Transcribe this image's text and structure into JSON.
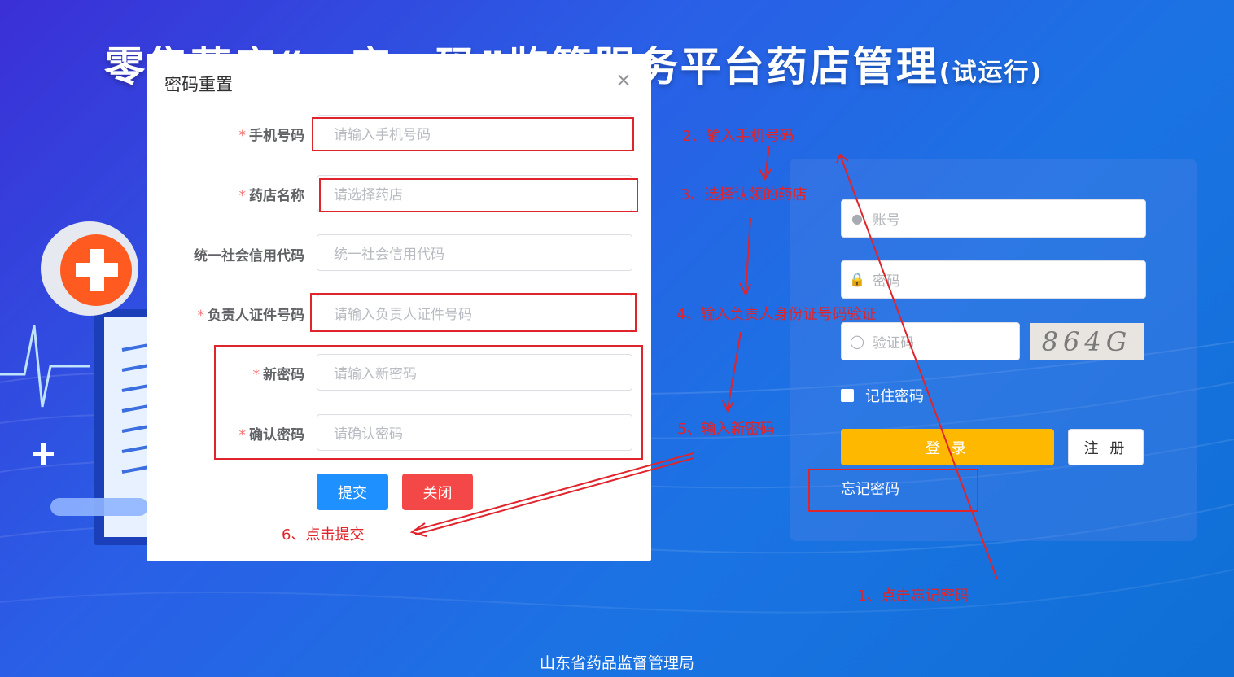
{
  "page": {
    "title": "零售药店“一店一码”监管服务平台药店管理",
    "title_suffix": "(试运行)",
    "footer": "山东省药品监督管理局"
  },
  "login": {
    "account_placeholder": "账号",
    "password_placeholder": "密码",
    "captcha_placeholder": "验证码",
    "captcha_text": "864G",
    "remember_label": "记住密码",
    "login_button": "登 录",
    "register_button": "注 册",
    "forgot_link": "忘记密码"
  },
  "modal": {
    "title": "密码重置",
    "close_icon": "×",
    "fields": [
      {
        "label": "手机号码",
        "required": true,
        "placeholder": "请输入手机号码"
      },
      {
        "label": "药店名称",
        "required": true,
        "placeholder": "请选择药店"
      },
      {
        "label": "统一社会信用代码",
        "required": false,
        "placeholder": "统一社会信用代码"
      },
      {
        "label": "负责人证件号码",
        "required": true,
        "placeholder": "请输入负责人证件号码"
      },
      {
        "label": "新密码",
        "required": true,
        "placeholder": "请输入新密码"
      },
      {
        "label": "确认密码",
        "required": true,
        "placeholder": "请确认密码"
      }
    ],
    "required_mark": "*",
    "submit_button": "提交",
    "close_button": "关闭"
  },
  "annotations": {
    "step1": "1、点击忘记密码",
    "step2": "2、输入手机号码",
    "step3": "3、选择认领的药店",
    "step4": "4、输入负责人身份证号码验证",
    "step5": "5、输入新密码",
    "step6": "6、点击提交"
  },
  "colors": {
    "annotation_red": "#e0242b",
    "login_button": "#ffb800",
    "submit_button": "#1e90ff",
    "close_button": "#f44848"
  }
}
